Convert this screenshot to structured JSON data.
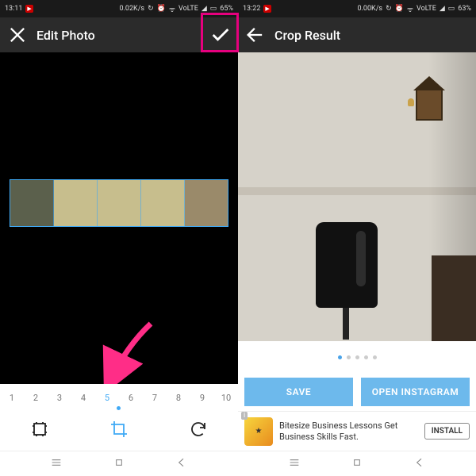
{
  "left": {
    "status": {
      "time": "13:11",
      "speed": "0.02K/s",
      "net": "VoLTE",
      "battery": "65%"
    },
    "appbar": {
      "title": "Edit Photo"
    },
    "slices": [
      "1",
      "2",
      "3",
      "4",
      "5",
      "6",
      "7",
      "8",
      "9",
      "10"
    ],
    "active_slice_index": 4
  },
  "right": {
    "status": {
      "time": "13:22",
      "speed": "0.00K/s",
      "net": "VoLTE",
      "battery": "63%"
    },
    "appbar": {
      "title": "Crop Result"
    },
    "page_dot_active": 0,
    "page_dot_count": 5,
    "buttons": {
      "save": "SAVE",
      "open": "OPEN INSTAGRAM"
    },
    "ad": {
      "headline": "Bitesize Business Lessons Get Business Skills Fast.",
      "cta": "INSTALL",
      "badge": "i"
    }
  },
  "annotations": {
    "confirm_highlight_color": "#e6007e",
    "arrow_color": "#ff2d87"
  }
}
